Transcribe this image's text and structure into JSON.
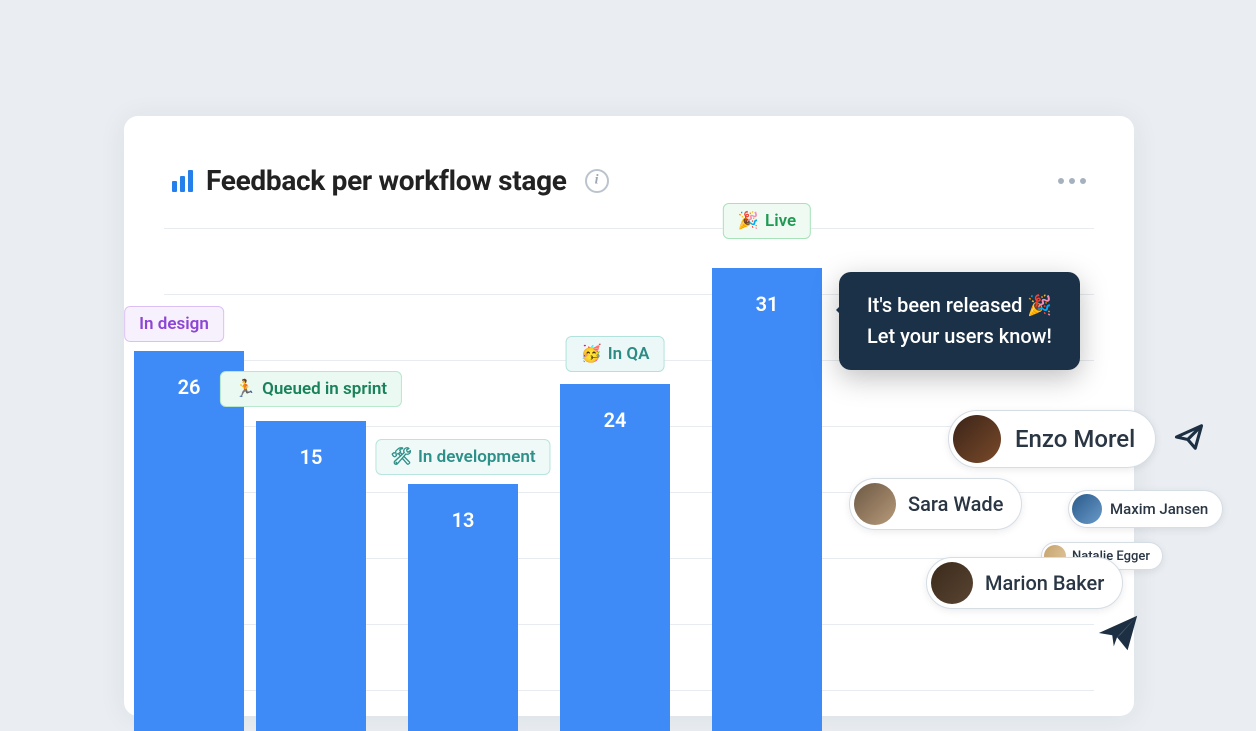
{
  "header": {
    "title": "Feedback per workflow stage"
  },
  "chart_data": {
    "type": "bar",
    "title": "Feedback per workflow stage",
    "xlabel": "",
    "ylabel": "",
    "ylim": [
      0,
      35
    ],
    "categories": [
      "In design",
      "Queued in sprint",
      "In development",
      "In QA",
      "Live"
    ],
    "values": [
      26,
      15,
      13,
      24,
      31
    ]
  },
  "stages": [
    {
      "label": "In design",
      "emoji": ""
    },
    {
      "label": "Queued in sprint",
      "emoji": "🏃"
    },
    {
      "label": "In development",
      "emoji": "🛠"
    },
    {
      "label": "In QA",
      "emoji": "🥳"
    },
    {
      "label": "Live",
      "emoji": "🎉"
    }
  ],
  "tooltip": {
    "line1": "It's been released 🎉",
    "line2": "Let your users know!"
  },
  "users": [
    {
      "name": "Enzo Morel"
    },
    {
      "name": "Sara Wade"
    },
    {
      "name": "Maxim Jansen"
    },
    {
      "name": "Natalie Egger"
    },
    {
      "name": "Marion Baker"
    }
  ]
}
